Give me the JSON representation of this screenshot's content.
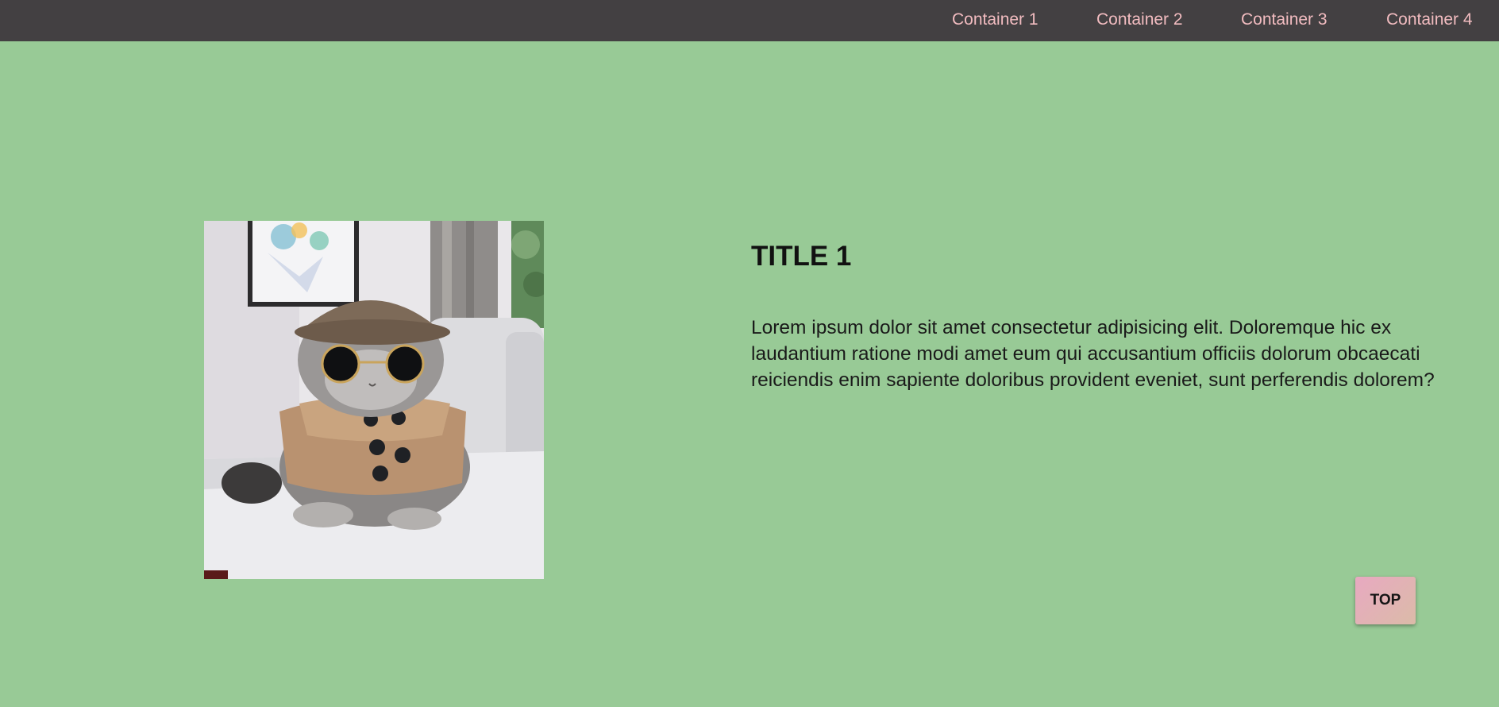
{
  "nav": {
    "items": [
      {
        "label": "Container 1"
      },
      {
        "label": "Container 2"
      },
      {
        "label": "Container 3"
      },
      {
        "label": "Container 4"
      }
    ]
  },
  "section": {
    "image_subject": "cat-photo",
    "title": "TITLE 1",
    "text": "Lorem ipsum dolor sit amet consectetur adipisicing elit. Doloremque hic ex laudantium ratione modi amet eum qui accusantium officiis dolorum obcaecati reiciendis enim sapiente doloribus provident eveniet, sunt perferendis dolorem?"
  },
  "top_button": {
    "label": "TOP"
  },
  "colors": {
    "page_background": "#98ca96",
    "navbar_background": "#434042",
    "nav_link": "#f2bcc0"
  }
}
